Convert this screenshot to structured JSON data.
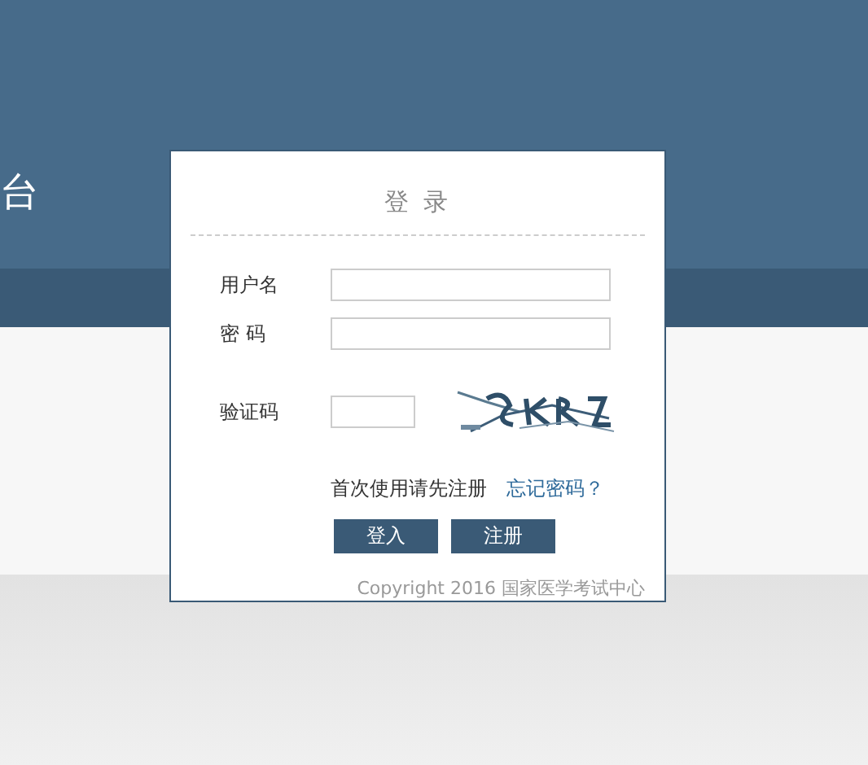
{
  "header": {
    "title": "台"
  },
  "login": {
    "title": "登 录",
    "fields": [
      {
        "label": "用户名",
        "kind": "text"
      },
      {
        "label": "密 码",
        "kind": "password"
      },
      {
        "label": "验证码",
        "kind": "captcha"
      }
    ],
    "register_hint": "首次使用请先注册",
    "forgot_link": "忘记密码？",
    "buttons": [
      "登入",
      "注册"
    ],
    "copyright": "Copyright 2016 国家医学考试中心"
  }
}
